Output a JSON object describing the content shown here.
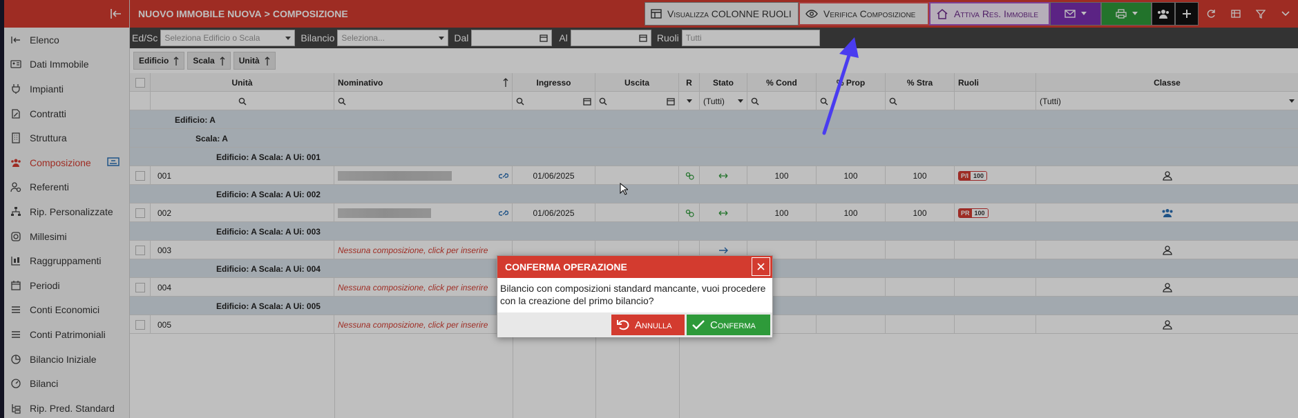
{
  "breadcrumb": {
    "parent": "NUOVO IMMOBILE NUOVA",
    "separator": ">",
    "current": "COMPOSIZIONE"
  },
  "toolbar": {
    "visualizza": "Visualizza COLONNE RUOLI",
    "verifica": "Verifica Composizione",
    "attiva": "Attiva Res. Immobile"
  },
  "sidebar": {
    "items": [
      {
        "label": "Elenco",
        "icon": "sign-in-icon"
      },
      {
        "label": "Dati Immobile",
        "icon": "id-card-icon"
      },
      {
        "label": "Impianti",
        "icon": "plug-icon"
      },
      {
        "label": "Contratti",
        "icon": "contract-icon"
      },
      {
        "label": "Struttura",
        "icon": "building-icon"
      },
      {
        "label": "Composizione",
        "icon": "people-icon"
      },
      {
        "label": "Referenti",
        "icon": "user-gear-icon"
      },
      {
        "label": "Rip. Personalizzate",
        "icon": "sitemap-icon"
      },
      {
        "label": "Millesimi",
        "icon": "dial-icon"
      },
      {
        "label": "Raggruppamenti",
        "icon": "group-icon"
      },
      {
        "label": "Periodi",
        "icon": "calendar-icon"
      },
      {
        "label": "Conti Economici",
        "icon": "list-icon"
      },
      {
        "label": "Conti Patrimoniali",
        "icon": "list-icon"
      },
      {
        "label": "Bilancio Iniziale",
        "icon": "pie-icon"
      },
      {
        "label": "Bilanci",
        "icon": "gauge-icon"
      },
      {
        "label": "Rip. Pred. Standard",
        "icon": "tree-icon"
      }
    ]
  },
  "filters": {
    "edsc_label": "Ed/Sc",
    "edsc_placeholder": "Seleziona Edificio o Scala",
    "bilancio_label": "Bilancio",
    "bilancio_placeholder": "Seleziona...",
    "dal_label": "Dal",
    "al_label": "Al",
    "ruoli_label": "Ruoli",
    "ruoli_placeholder": "Tutti"
  },
  "grouping": [
    "Edificio",
    "Scala",
    "Unità"
  ],
  "columns": {
    "unita": "Unità",
    "nominativo": "Nominativo",
    "ingresso": "Ingresso",
    "uscita": "Uscita",
    "r": "R",
    "stato": "Stato",
    "cond": "% Cond",
    "prop": "% Prop",
    "stra": "% Stra",
    "ruoli": "Ruoli",
    "classe": "Classe"
  },
  "filter_row": {
    "stato": "(Tutti)",
    "classe": "(Tutti)"
  },
  "groups": {
    "edificio": "Edificio: A",
    "scala": "Scala: A"
  },
  "rows": [
    {
      "group": "Edificio: A Scala: A Ui: 001",
      "unit": "001",
      "ingresso": "01/06/2025",
      "cond": "100",
      "prop": "100",
      "stra": "100",
      "role": "P/I",
      "role_pct": "100"
    },
    {
      "group": "Edificio: A Scala: A Ui: 002",
      "unit": "002",
      "ingresso": "01/06/2025",
      "cond": "100",
      "prop": "100",
      "stra": "100",
      "role": "PR",
      "role_pct": "100"
    },
    {
      "group": "Edificio: A Scala: A Ui: 003",
      "unit": "003",
      "nominativo": "Nessuna composizione, click per inserire"
    },
    {
      "group": "Edificio: A Scala: A Ui: 004",
      "unit": "004",
      "nominativo": "Nessuna composizione, click per inserire"
    },
    {
      "group": "Edificio: A Scala: A Ui: 005",
      "unit": "005",
      "nominativo": "Nessuna composizione, click per inserire"
    }
  ],
  "dialog": {
    "title": "CONFERMA OPERAZIONE",
    "message": "Bilancio con composizioni standard mancante, vuoi procedere con la creazione del primo bilancio?",
    "cancel": "Annulla",
    "confirm": "Conferma"
  },
  "colors": {
    "accent": "#d33b2f",
    "purple": "#7a2fb0",
    "green": "#2e9a3a",
    "arrow": "#4a3cf0"
  }
}
